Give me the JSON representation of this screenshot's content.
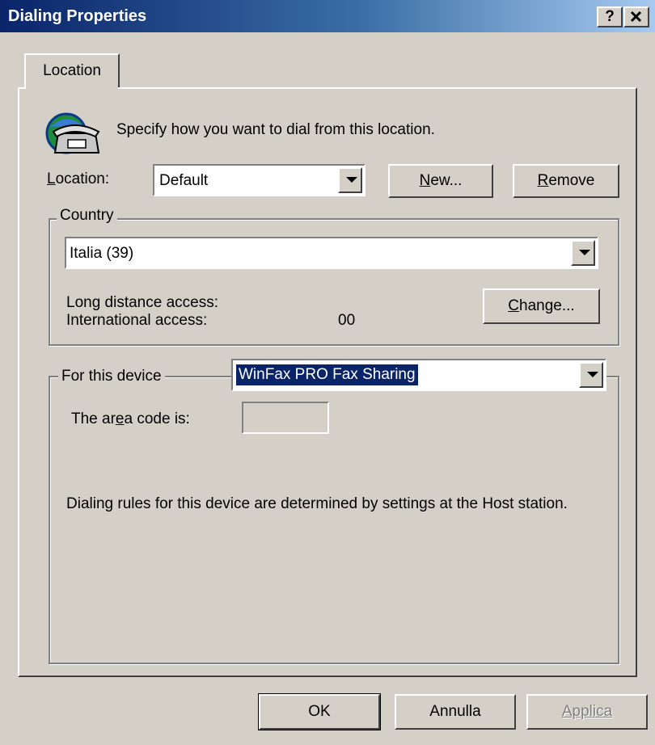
{
  "window": {
    "title": "Dialing Properties",
    "help_label": "?",
    "close_label": "×"
  },
  "tabs": [
    {
      "label": "Location"
    }
  ],
  "intro_text": "Specify how you want to dial from this location.",
  "location": {
    "label_pre": "L",
    "label_post": "ocation:",
    "value": "Default",
    "new_pre": "N",
    "new_post": "ew...",
    "remove_pre": "R",
    "remove_post": "emove"
  },
  "country": {
    "group_label": "Country",
    "value": "Italia (39)",
    "long_distance_label": "Long distance access:",
    "international_label": "International access:",
    "international_value": "00",
    "change_pre": "C",
    "change_post": "hange..."
  },
  "device": {
    "group_label": "For this device",
    "value": "WinFax PRO Fax Sharing",
    "area_code_pre": "The ar",
    "area_code_u": "e",
    "area_code_post": "a code is:",
    "area_code_value": "",
    "rules_text": "Dialing rules for this device are determined by settings at the Host station."
  },
  "buttons": {
    "ok": "OK",
    "cancel": "Annulla",
    "apply": "Applica"
  }
}
